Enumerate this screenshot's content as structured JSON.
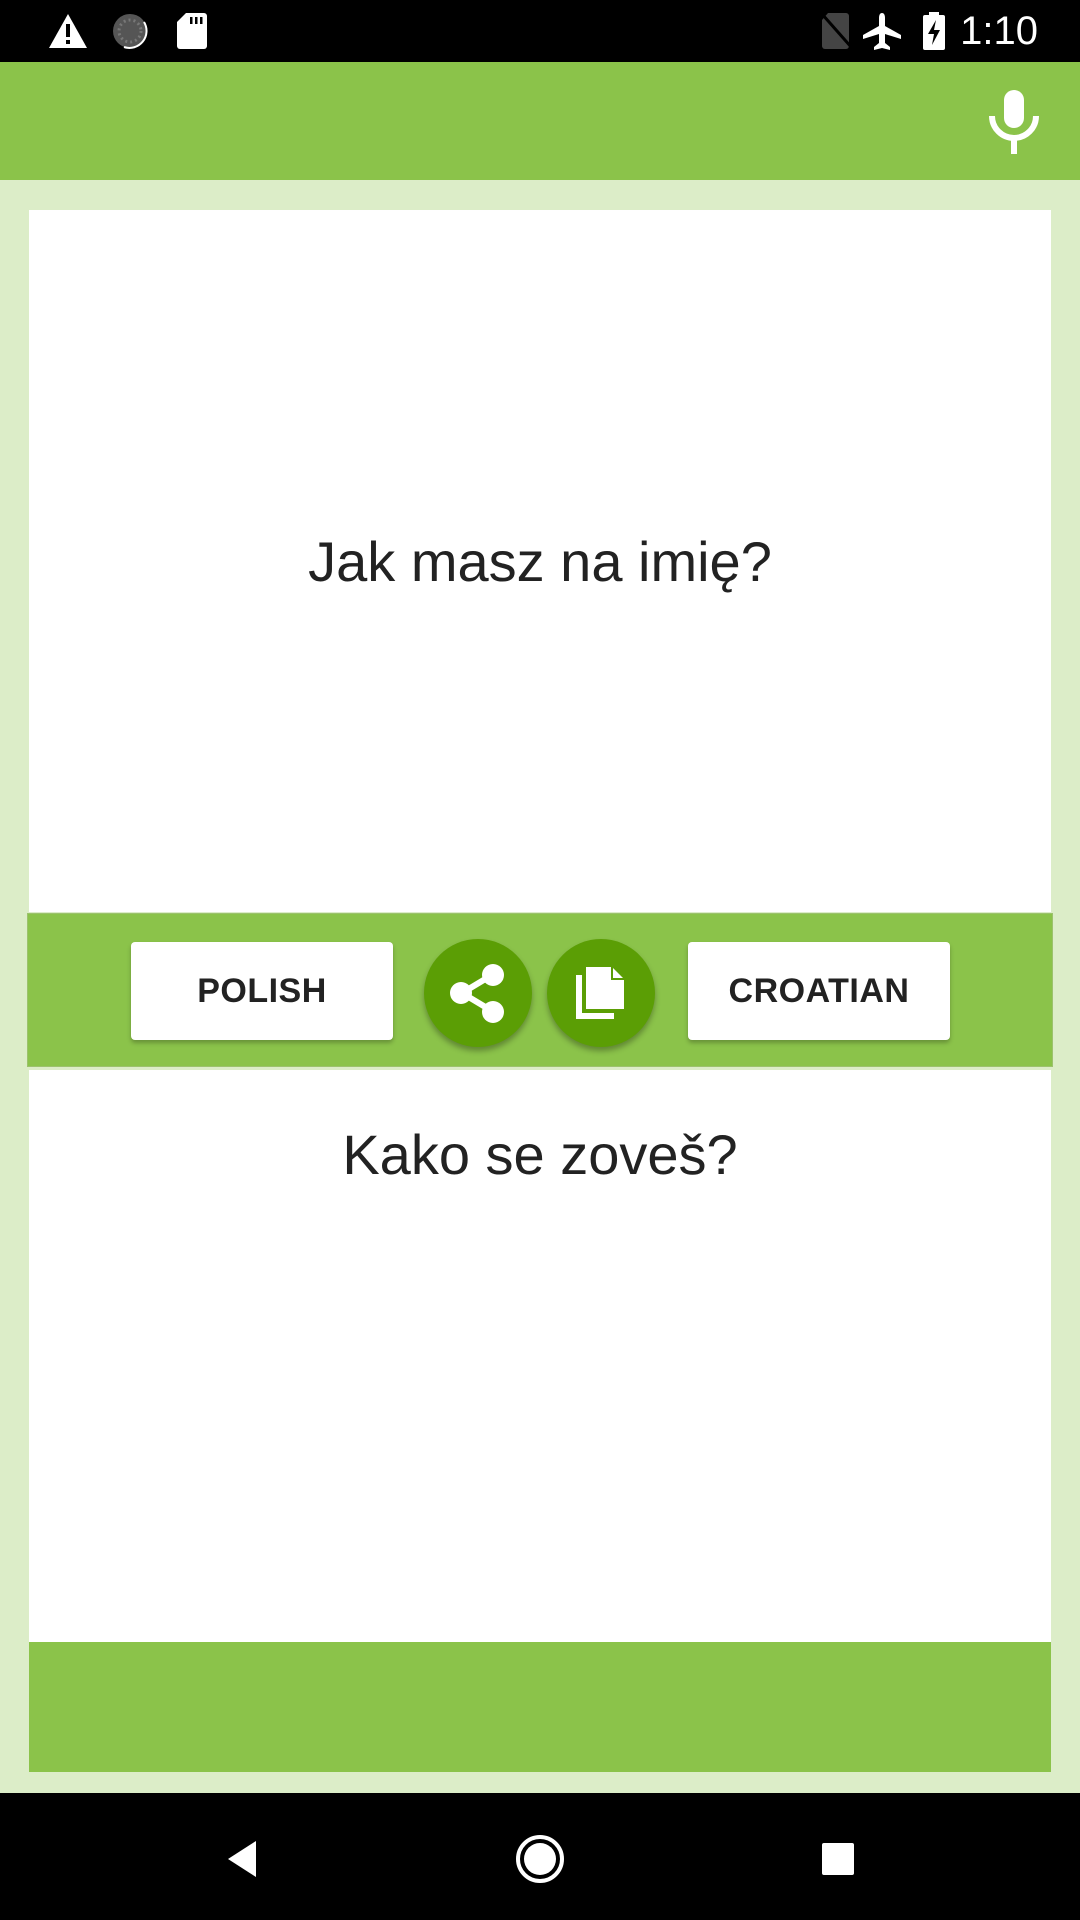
{
  "status_bar": {
    "time": "1:10",
    "left_icons": [
      "warning-icon",
      "sync-icon",
      "sd-card-icon"
    ],
    "right_icons": [
      "no-sim-icon",
      "airplane-mode-icon",
      "battery-charging-icon"
    ]
  },
  "app_bar": {
    "mic_icon": "microphone-icon"
  },
  "source": {
    "text": "Jak masz na imię?"
  },
  "toolbar": {
    "source_language": "POLISH",
    "target_language": "CROATIAN",
    "share_icon": "share-icon",
    "copy_icon": "copy-icon"
  },
  "target": {
    "text": "Kako se zoveš?"
  },
  "nav_bar": {
    "back": "back-icon",
    "home": "home-icon",
    "recents": "recents-icon"
  },
  "colors": {
    "primary": "#8BC34A",
    "primary_dark": "#5B9E05",
    "background": "#DCEDC8"
  }
}
